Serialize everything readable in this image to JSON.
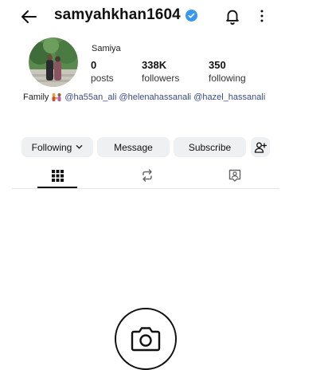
{
  "header": {
    "username": "samyahkhan1604",
    "verified_color": "#3897f0",
    "icons": [
      "back-arrow-icon",
      "verified-badge-icon",
      "bell-icon",
      "more-options-icon"
    ]
  },
  "profile": {
    "display_name": "Samiya",
    "stats": {
      "posts_count": "0",
      "posts_label": "posts",
      "followers_count": "338K",
      "followers_label": "followers",
      "following_count": "350",
      "following_label": "following"
    },
    "bio": {
      "prefix": "Family",
      "mentions": [
        "@ha55an_ali",
        "@helenahassanali",
        "@hazel_hassanali"
      ]
    }
  },
  "actions": {
    "following_label": "Following",
    "message_label": "Message",
    "subscribe_label": "Subscribe"
  },
  "tabs": [
    "grid-icon",
    "reposts-icon",
    "tagged-icon"
  ],
  "empty_state": {
    "icon": "camera-icon"
  }
}
